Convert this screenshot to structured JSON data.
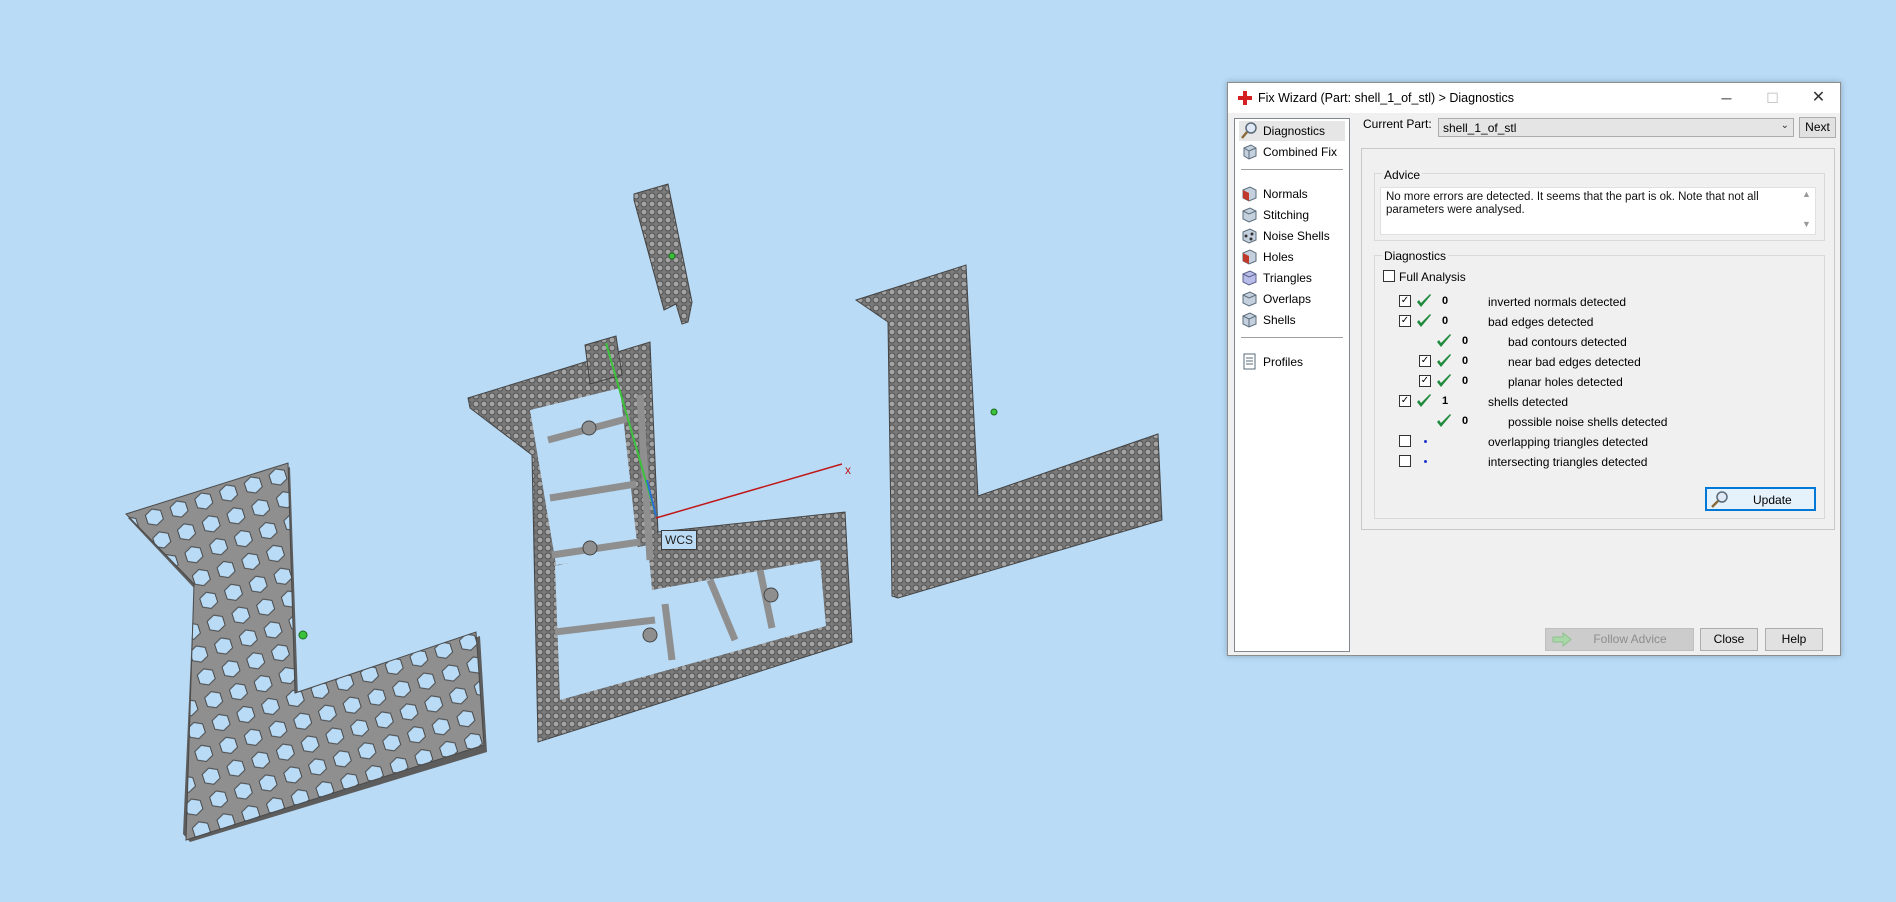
{
  "viewport": {
    "wcs_label": "WCS",
    "axis_x_label": "x"
  },
  "dialog": {
    "title": "Fix Wizard (Part: shell_1_of_stl) > Diagnostics",
    "window_buttons": {
      "minimize": "─",
      "maximize": "☐",
      "close": "✕"
    },
    "nav": {
      "items_top": [
        {
          "label": "Diagnostics",
          "icon": "magnifier-icon",
          "selected": true
        },
        {
          "label": "Combined Fix",
          "icon": "cube-fix-icon",
          "selected": false
        }
      ],
      "items_mid": [
        {
          "label": "Normals",
          "icon": "normals-cube-icon"
        },
        {
          "label": "Stitching",
          "icon": "stitching-cube-icon"
        },
        {
          "label": "Noise Shells",
          "icon": "noise-shells-icon"
        },
        {
          "label": "Holes",
          "icon": "holes-cube-icon"
        },
        {
          "label": "Triangles",
          "icon": "triangles-cube-icon"
        },
        {
          "label": "Overlaps",
          "icon": "overlaps-cube-icon"
        },
        {
          "label": "Shells",
          "icon": "shells-cube-icon"
        }
      ],
      "items_bottom": [
        {
          "label": "Profiles",
          "icon": "profiles-document-icon"
        }
      ]
    },
    "current_part": {
      "label": "Current Part:",
      "value": "shell_1_of_stl",
      "next_label": "Next"
    },
    "advice": {
      "heading": "Advice",
      "text": "No more errors are detected. It seems that the part is ok. Note that not all parameters were analysed."
    },
    "diagnostics": {
      "heading": "Diagnostics",
      "full_analysis_label": "Full Analysis",
      "full_analysis_checked": false,
      "rows": [
        {
          "checked": true,
          "status": "ok",
          "count": "0",
          "label": "inverted normals detected",
          "indent": 0
        },
        {
          "checked": true,
          "status": "ok",
          "count": "0",
          "label": "bad edges detected",
          "indent": 0
        },
        {
          "checked": null,
          "status": "ok",
          "count": "0",
          "label": "bad contours detected",
          "indent": 1
        },
        {
          "checked": true,
          "status": "ok",
          "count": "0",
          "label": "near bad edges detected",
          "indent": 1
        },
        {
          "checked": true,
          "status": "ok",
          "count": "0",
          "label": "planar holes detected",
          "indent": 1
        },
        {
          "checked": true,
          "status": "ok",
          "count": "1",
          "label": "shells detected",
          "indent": 0
        },
        {
          "checked": null,
          "status": "ok",
          "count": "0",
          "label": "possible noise shells detected",
          "indent": 1
        },
        {
          "checked": false,
          "status": "pending",
          "count": "",
          "label": "overlapping triangles detected",
          "indent": 0
        },
        {
          "checked": false,
          "status": "pending",
          "count": "",
          "label": "intersecting triangles detected",
          "indent": 0
        }
      ],
      "update_label": "Update"
    },
    "footer": {
      "follow_advice_label": "Follow Advice",
      "close_label": "Close",
      "help_label": "Help"
    }
  },
  "colors": {
    "background": "#b9dbf6",
    "part_fill": "#8d8d8d",
    "check_green": "#1e8a3c",
    "focus_blue": "#0078d7"
  }
}
